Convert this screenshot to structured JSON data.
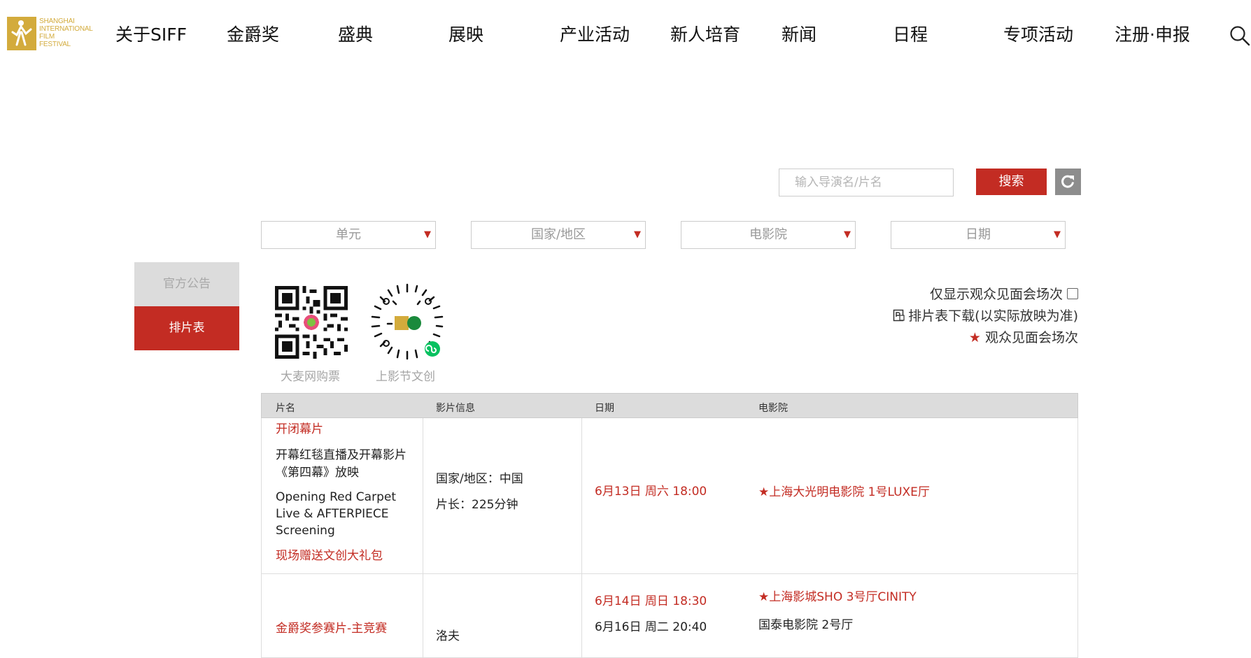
{
  "nav": {
    "logo_lines": [
      "SHANGHAI",
      "INTERNATIONAL",
      "FILM",
      "FESTIVAL"
    ],
    "logo_letters": "SIFF",
    "items": [
      "关于SIFF",
      "金爵奖",
      "盛典",
      "展映",
      "产业活动",
      "新人培育",
      "新闻",
      "日程",
      "专项活动",
      "注册·申报"
    ]
  },
  "search": {
    "placeholder": "输入导演名/片名",
    "button_label": "搜索"
  },
  "filters": [
    "单元",
    "国家/地区",
    "电影院",
    "日期"
  ],
  "sidebar": {
    "items": [
      "官方公告",
      "排片表"
    ]
  },
  "qr": {
    "labels": [
      "大麦网购票",
      "上影节文创"
    ]
  },
  "options": {
    "audience_only": "仅显示观众见面会场次",
    "download": "排片表下载(以实际放映为准)",
    "legend": "观众见面会场次"
  },
  "table": {
    "headers": [
      "片名",
      "影片信息",
      "日期",
      "电影院"
    ],
    "rows": [
      {
        "category": "开闭幕片",
        "title_cn": "开幕红毯直播及开幕影片《第四幕》放映",
        "title_en": "Opening Red Carpet Live & AFTERPIECE Screening",
        "note": "现场赠送文创大礼包",
        "info_country": "国家/地区：中国",
        "info_length": "片长：225分钟",
        "dates": [
          "6月13日 周六 18:00"
        ],
        "cinemas": [
          "★上海大光明电影院 1号LUXE厅"
        ]
      },
      {
        "category": "金爵奖参赛片-主竞赛",
        "info_partial": "洛夫",
        "dates": [
          "6月14日 周日 18:30",
          "6月16日 周二 20:40"
        ],
        "cinemas": [
          "★上海影城SHO 3号厅CINITY",
          "国泰电影院 2号厅"
        ]
      }
    ]
  },
  "colors": {
    "brand_gold": "#d3ab3c",
    "accent_red": "#c32c23",
    "header_gray": "#dcdcdc"
  }
}
